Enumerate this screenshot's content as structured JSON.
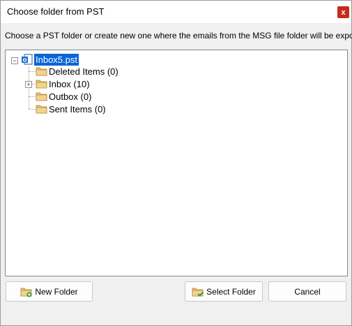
{
  "window": {
    "title": "Choose folder from PST",
    "close_label": "x"
  },
  "instruction": "Choose a PST folder or create new one where the emails from the MSG file folder will be exported",
  "tree": {
    "root": {
      "label": "Inbox5.pst",
      "expander": "⊟",
      "icon": "pst-file-icon",
      "selected": true
    },
    "children": [
      {
        "label": "Deleted Items (0)",
        "icon": "folder-icon",
        "has_children": false
      },
      {
        "label": "Inbox (10)",
        "icon": "folder-icon",
        "has_children": true,
        "expander": "+"
      },
      {
        "label": "Outbox (0)",
        "icon": "folder-icon",
        "has_children": false
      },
      {
        "label": "Sent Items (0)",
        "icon": "folder-icon",
        "has_children": false
      }
    ]
  },
  "buttons": {
    "new_folder": "New Folder",
    "select_folder": "Select Folder",
    "cancel": "Cancel"
  },
  "colors": {
    "selection": "#0a64d6",
    "close_button": "#c42b1c",
    "folder": "#e8c070"
  }
}
